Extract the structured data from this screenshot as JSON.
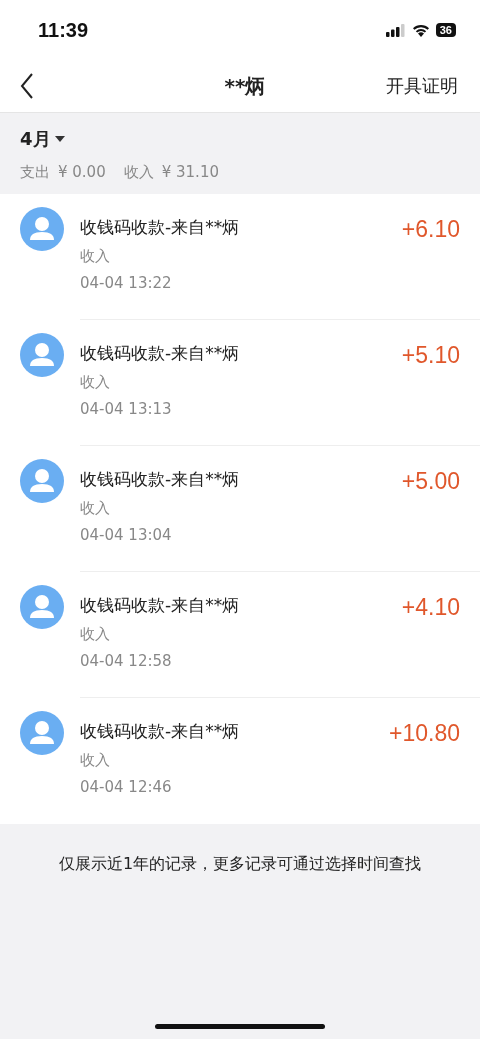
{
  "status_bar": {
    "time": "11:39",
    "battery": "36"
  },
  "nav": {
    "title": "**炳",
    "action": "开具证明"
  },
  "summary": {
    "month": "4月",
    "expense_label": "支出",
    "expense": "¥ 0.00",
    "income_label": "收入",
    "income": "¥ 31.10"
  },
  "transactions": [
    {
      "title": "收钱码收款-来自**炳",
      "type": "收入",
      "time": "04-04  13:22",
      "amount": "+6.10"
    },
    {
      "title": "收钱码收款-来自**炳",
      "type": "收入",
      "time": "04-04  13:13",
      "amount": "+5.10"
    },
    {
      "title": "收钱码收款-来自**炳",
      "type": "收入",
      "time": "04-04  13:04",
      "amount": "+5.00"
    },
    {
      "title": "收钱码收款-来自**炳",
      "type": "收入",
      "time": "04-04  12:58",
      "amount": "+4.10"
    },
    {
      "title": "收钱码收款-来自**炳",
      "type": "收入",
      "time": "04-04  12:46",
      "amount": "+10.80"
    }
  ],
  "footer_note": "仅展示近1年的记录，更多记录可通过选择时间查找"
}
